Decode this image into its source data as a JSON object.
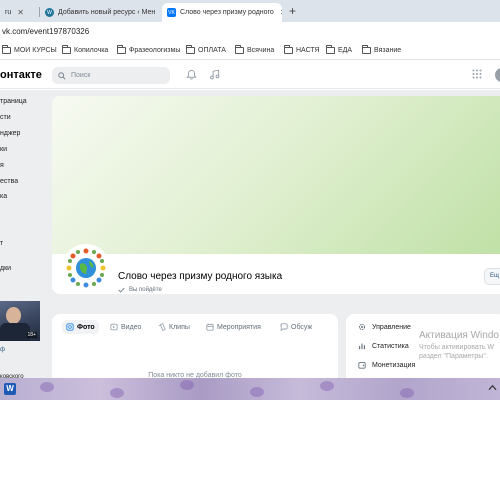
{
  "browser": {
    "tabs": [
      {
        "label": "ru",
        "active": false
      },
      {
        "label": "Добавить новый ресурс ‹ Мен",
        "active": false
      },
      {
        "label": "Слово через призму родного",
        "active": true
      }
    ],
    "new_tab_symbol": "+",
    "close_symbol": "✕",
    "url": "vk.com/event197870326",
    "bookmarks": [
      "МОИ КУРСЫ",
      "Копилочка",
      "Фразеологизмы",
      "ОПЛАТА",
      "Всячина",
      "НАСТЯ",
      "ЕДА",
      "Вязание"
    ]
  },
  "vk": {
    "logo_text": "онтакте",
    "search_placeholder": "Поиск",
    "left_nav": [
      "траница",
      "сти",
      "нджер",
      "ки",
      "я",
      "ества",
      "ка",
      "т",
      "дки"
    ],
    "ad": {
      "age_label": "18+",
      "caption_1": "ф",
      "caption_2": "ковского"
    },
    "group": {
      "name": "Слово через призму родного языка",
      "status": "Вы пойдёте",
      "more_label": "Ещ"
    },
    "content_tabs": [
      "Фото",
      "Видео",
      "Клипы",
      "Мероприятия",
      "Обсуж"
    ],
    "empty_message": "Пока никто не добавил фото",
    "right_menu": [
      "Управление",
      "Статистика",
      "Монетизация"
    ]
  },
  "windows": {
    "activation_title": "Активация Windo",
    "activation_line1": "Чтобы активировать W",
    "activation_line2": "раздел \"Параметры\".",
    "word_icon_letter": "W"
  },
  "colors": {
    "vk_blue": "#0077ff",
    "cover_green": "#bfe0a5",
    "word_blue": "#1e5ab5"
  }
}
